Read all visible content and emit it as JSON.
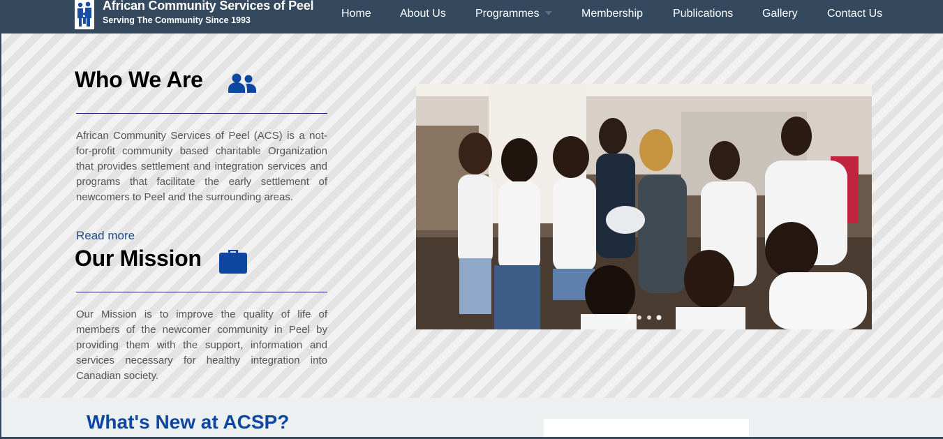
{
  "brand": {
    "title": "African Community Services of Peel",
    "subtitle": "Serving The Community Since 1993"
  },
  "nav": {
    "home": "Home",
    "about": "About Us",
    "programmes": "Programmes",
    "membership": "Membership",
    "publications": "Publications",
    "gallery": "Gallery",
    "contact": "Contact Us"
  },
  "who": {
    "title": "Who We Are",
    "text": "African Community Services of Peel (ACS) is a not-for-profit community based charitable Organization that provides settlement and integration services and programs that facilitate the early settlement of newcomers to Peel and the surrounding areas.",
    "read_more": "Read more"
  },
  "mission": {
    "title": "Our Mission",
    "text": "Our Mission is to improve the quality of life of members of the newcomer community in Peel by providing them with the support, information and services necessary for healthy integration into Canadian society."
  },
  "news": {
    "title": "What's New at ACSP?"
  },
  "icons": {
    "logo": "family-logo-icon",
    "who": "users-icon",
    "mission": "briefcase-icon"
  },
  "colors": {
    "navbar": "#34495e",
    "accent_blue": "#0d47a1",
    "link": "#1f4e8c",
    "rule": "#1a237e"
  }
}
